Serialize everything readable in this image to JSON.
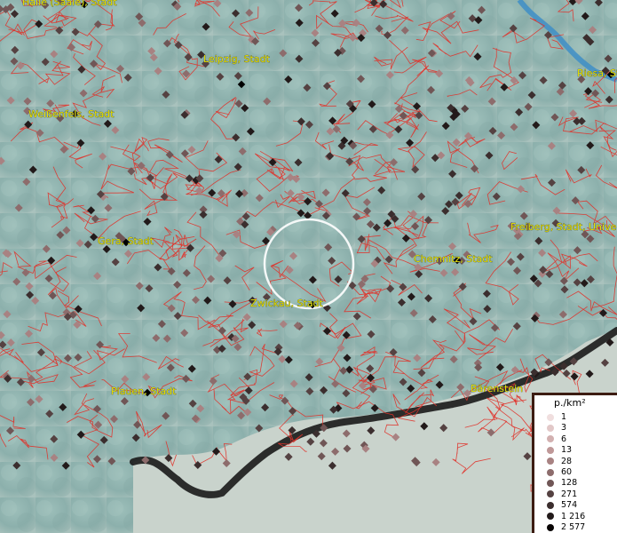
{
  "map": {
    "cities": [
      {
        "name": "Halle (Saale), Stadt",
        "id": "halle"
      },
      {
        "name": "Leipzig, Stadt",
        "id": "leipzig"
      },
      {
        "name": "Riesa, Sta",
        "id": "riesa"
      },
      {
        "name": "Weißenfels, Stadt",
        "id": "weissenfels"
      },
      {
        "name": "Gera, Stadt",
        "id": "gera"
      },
      {
        "name": "Freiberg, Stadt, Universi",
        "id": "freiberg"
      },
      {
        "name": "Chemnitz, Stadt",
        "id": "chemnitz"
      },
      {
        "name": "Zwickau, Stadt",
        "id": "zwickau"
      },
      {
        "name": "Plauen, Stadt",
        "id": "plauen"
      },
      {
        "name": "Bärenstein",
        "id": "baerenstein"
      }
    ]
  },
  "legend": {
    "title": "p./km²",
    "entries": [
      {
        "label": "1",
        "color": "#f0dede"
      },
      {
        "label": "3",
        "color": "#e2c8c8"
      },
      {
        "label": "6",
        "color": "#d2b0b0"
      },
      {
        "label": "13",
        "color": "#bf9898"
      },
      {
        "label": "28",
        "color": "#a88282"
      },
      {
        "label": "60",
        "color": "#8d6c6c"
      },
      {
        "label": "128",
        "color": "#705656"
      },
      {
        "label": "271",
        "color": "#554242"
      },
      {
        "label": "574",
        "color": "#3b2e2e"
      },
      {
        "label": "1 216",
        "color": "#221a1a"
      },
      {
        "label": "2 577",
        "color": "#080404"
      }
    ]
  }
}
